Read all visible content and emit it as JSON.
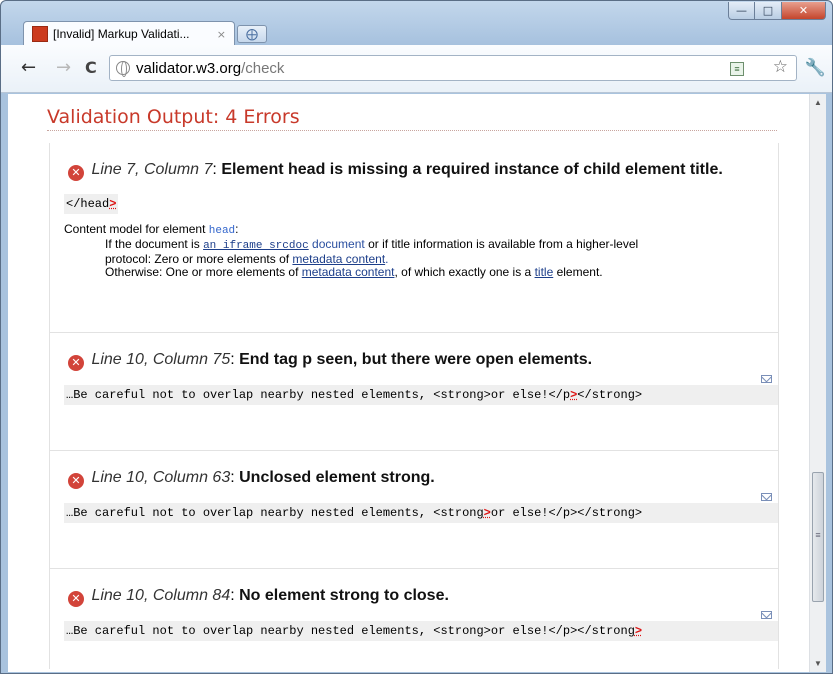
{
  "browser": {
    "tab_title": "[Invalid] Markup Validati...",
    "tab_close": "×",
    "url_host": "validator.w3.org",
    "url_path": "/check"
  },
  "page": {
    "heading": "Validation Output: 4 Errors"
  },
  "errors": [
    {
      "location": "Line 7, Column 7",
      "message": "Element head is missing a required instance of child element title.",
      "extract_before": "</head",
      "extract_marker": ">",
      "extract_after": "",
      "content_model": {
        "intro": "Content model for element ",
        "element": "head",
        "colon": ":",
        "line1_a": "If the document is ",
        "line1_link_code": "an iframe srcdoc",
        "line1_link_doc": " document",
        "line1_b": " or if title information is available from a higher-level",
        "line2_a": "protocol: Zero or more elements of ",
        "line2_link": "metadata content",
        "line2_b": ".",
        "line3_a": "Otherwise: One or more elements of ",
        "line3_link": "metadata content",
        "line3_b": ", of which exactly one is a ",
        "line3_link2": "title",
        "line3_c": " element."
      }
    },
    {
      "location": "Line 10, Column 75",
      "message": "End tag p seen, but there were open elements.",
      "extract_before": "…Be careful not to overlap nearby nested elements, <strong>or else!</p",
      "extract_marker": ">",
      "extract_after": "</strong>"
    },
    {
      "location": "Line 10, Column 63",
      "message": "Unclosed element strong.",
      "extract_before": "…Be careful not to overlap nearby nested elements, <strong",
      "extract_marker": ">",
      "extract_after": "or else!</p></strong>"
    },
    {
      "location": "Line 10, Column 84",
      "message": "No element strong to close.",
      "extract_before": "…Be careful not to overlap nearby nested elements, <strong>or else!</p></strong",
      "extract_marker": ">",
      "extract_after": ""
    }
  ],
  "colors": {
    "heading": "#c8392a",
    "error_icon": "#d2443a",
    "link": "#1c3e8a"
  },
  "icons": [
    "error-icon",
    "mail-icon",
    "globe-icon",
    "star-icon",
    "wrench-icon",
    "back-arrow-icon",
    "forward-arrow-icon",
    "reload-icon"
  ]
}
